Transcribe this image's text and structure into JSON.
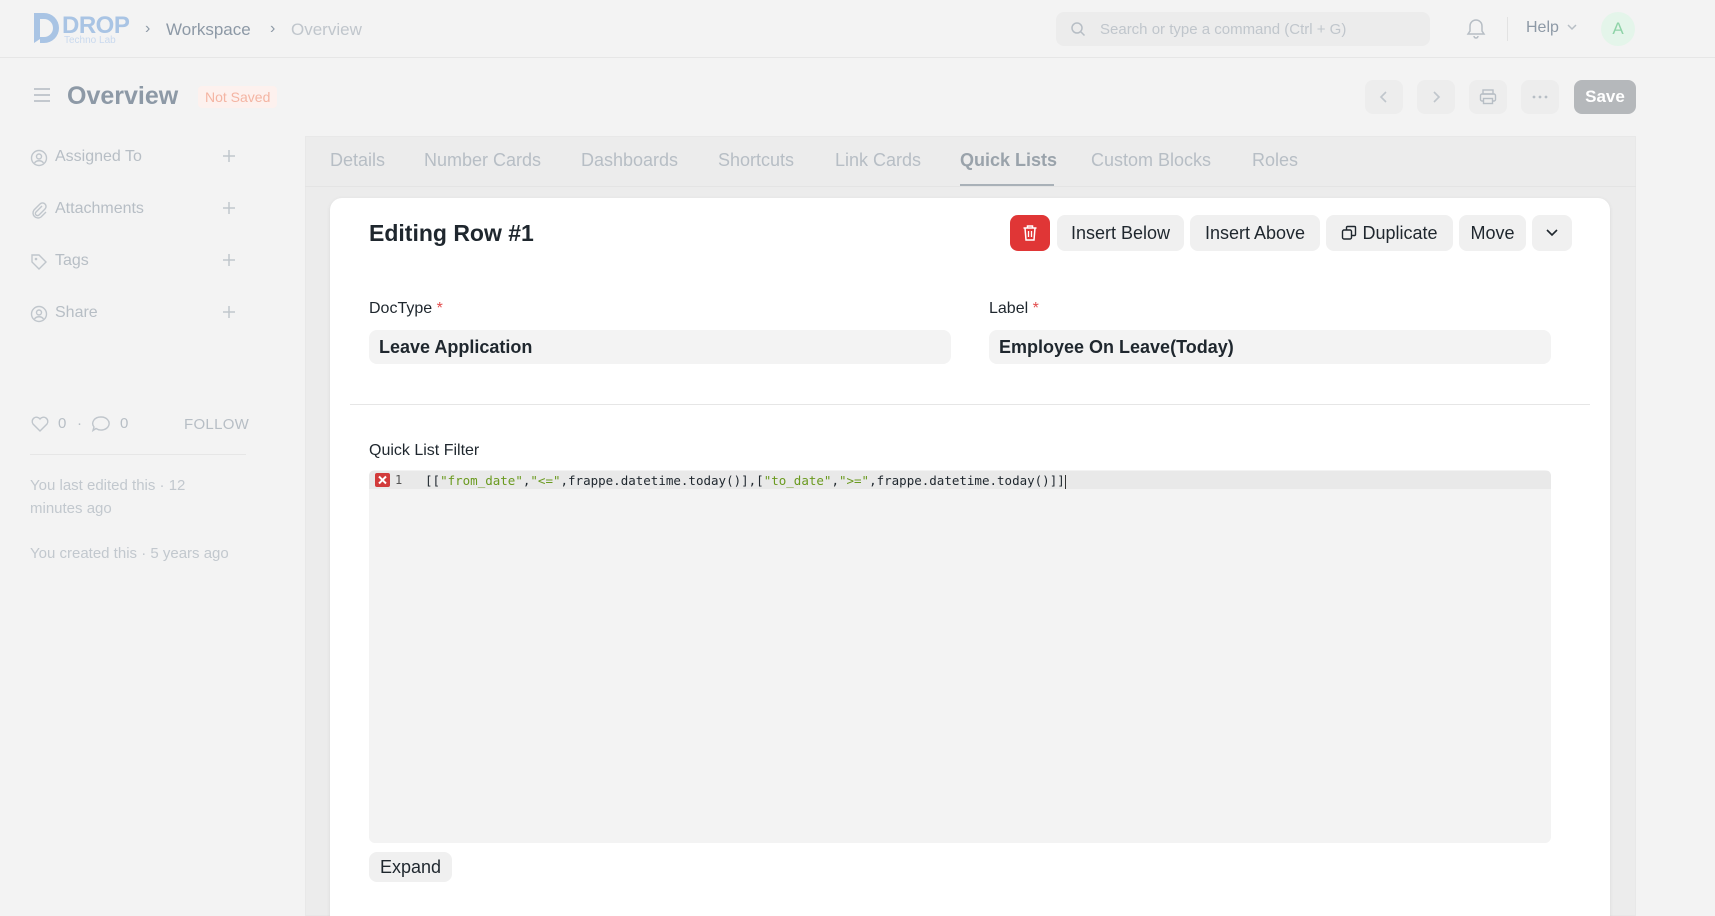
{
  "brand": {
    "name": "DROP",
    "tagline": "Techno Lab"
  },
  "breadcrumb": [
    "Workspace",
    "Overview"
  ],
  "search": {
    "placeholder": "Search or type a command (Ctrl + G)"
  },
  "navbar": {
    "help_label": "Help",
    "avatar_initial": "A"
  },
  "page": {
    "title": "Overview",
    "status": "Not Saved",
    "save_label": "Save"
  },
  "sidebar": {
    "items": [
      {
        "label": "Assigned To",
        "icon": "user-circle-icon"
      },
      {
        "label": "Attachments",
        "icon": "paperclip-icon"
      },
      {
        "label": "Tags",
        "icon": "tag-icon"
      },
      {
        "label": "Share",
        "icon": "share-icon"
      }
    ],
    "likes": "0",
    "comments": "0",
    "follow_label": "FOLLOW",
    "last_edited": "You last edited this · 12 minutes ago",
    "created": "You created this · 5 years ago"
  },
  "tabs": [
    {
      "label": "Details",
      "active": false
    },
    {
      "label": "Number Cards",
      "active": false
    },
    {
      "label": "Dashboards",
      "active": false
    },
    {
      "label": "Shortcuts",
      "active": false
    },
    {
      "label": "Link Cards",
      "active": false
    },
    {
      "label": "Quick Lists",
      "active": true
    },
    {
      "label": "Custom Blocks",
      "active": false
    },
    {
      "label": "Roles",
      "active": false
    }
  ],
  "editor": {
    "title": "Editing Row #1",
    "actions": {
      "insert_below": "Insert Below",
      "insert_above": "Insert Above",
      "duplicate": "Duplicate",
      "move": "Move"
    },
    "doctype": {
      "label": "DocType",
      "required_mark": "*",
      "value": "Leave Application"
    },
    "label_field": {
      "label": "Label",
      "required_mark": "*",
      "value": "Employee On Leave(Today)"
    },
    "filter": {
      "label": "Quick List Filter",
      "line_number": "1",
      "code_tokens": [
        "[[",
        "\"from_date\"",
        ",",
        "\"<=\"",
        ",frappe.datetime.today()],[",
        "\"to_date\"",
        ",",
        "\">=\"",
        ",frappe.datetime.today()]]"
      ]
    },
    "expand_label": "Expand"
  },
  "colors": {
    "accent_red": "#e03636",
    "code_string": "#6a9a1f"
  }
}
